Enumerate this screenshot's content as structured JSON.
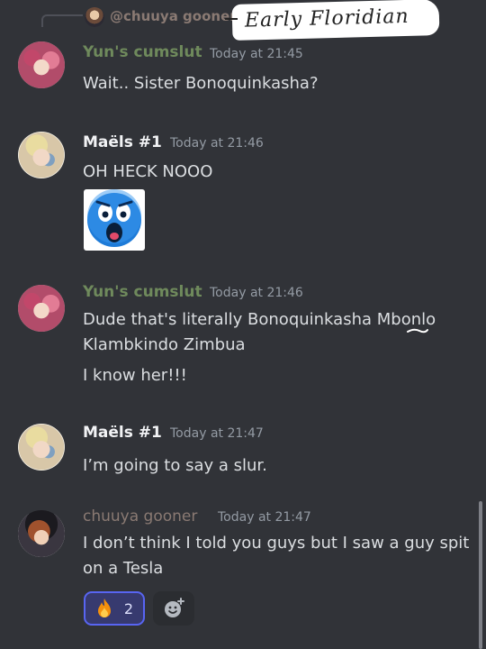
{
  "reply": {
    "author": "@chuuya gooner",
    "annotation": "Early Floridian"
  },
  "messages": [
    {
      "author": "Yun's cumslut",
      "timestamp": "Today at 21:45",
      "lines": [
        "Wait.. Sister Bonoquinkasha?"
      ]
    },
    {
      "author": "Maëls #1",
      "timestamp": "Today at 21:46",
      "lines": [
        "OH HECK NOOO"
      ]
    },
    {
      "author": "Yun's cumslut",
      "timestamp": "Today at 21:46",
      "lines": [
        "Dude that's literally Bonoquinkasha Mbonlo",
        "Klambkindo Zimbua",
        "I know her!!!"
      ]
    },
    {
      "author": "Maëls #1",
      "timestamp": "Today at 21:47",
      "lines": [
        "I’m going to say a slur."
      ]
    },
    {
      "author": "chuuya gooner",
      "timestamp": "Today at 21:47",
      "lines": [
        "I don’t think I told you guys but I saw a guy spit",
        "on a Tesla"
      ]
    }
  ],
  "reaction": {
    "emoji": "fire",
    "count": "2"
  },
  "colors": {
    "background": "#313338",
    "accent": "#5865f2",
    "emoji_blue": "#1e7bd8"
  }
}
